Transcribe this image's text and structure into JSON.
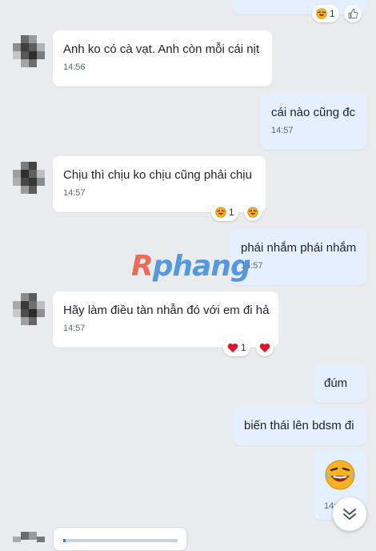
{
  "watermark": {
    "part1": "R",
    "part2": "phang"
  },
  "messages": [
    {
      "dir": "out",
      "text": "",
      "reactions": [
        {
          "icon": "laugh-emoji",
          "count": "1"
        },
        {
          "icon": "thumbs-up",
          "count": ""
        }
      ]
    },
    {
      "dir": "in",
      "text": "Anh ko có cà vạt. Anh còn mỗi cái nịt",
      "time": "14:56"
    },
    {
      "dir": "out",
      "text": "cái nào cũng đc",
      "time": "14:57"
    },
    {
      "dir": "in",
      "text": "Chịu thì chịu ko chịu cũng phải chịu",
      "time": "14:57",
      "reactions": [
        {
          "icon": "laugh-emoji",
          "count": "1"
        },
        {
          "icon": "laugh-emoji",
          "count": ""
        }
      ]
    },
    {
      "dir": "out",
      "text": "phái nhắm phái nhắm",
      "time": "14:57"
    },
    {
      "dir": "in",
      "text": "Hãy làm điều tàn nhẫn đó với em đi hả",
      "time": "14:57",
      "reactions": [
        {
          "icon": "heart",
          "count": "1"
        },
        {
          "icon": "heart",
          "count": ""
        }
      ]
    },
    {
      "dir": "out",
      "text": "đúm"
    },
    {
      "dir": "out",
      "text": "biến thái lên bdsm đi"
    },
    {
      "dir": "out",
      "sticker": "laughing-tears-emoji",
      "time": "14:5"
    }
  ],
  "colors": {
    "background": "#e9ebee",
    "incoming": "#ffffff",
    "outgoing": "#e4efff"
  }
}
